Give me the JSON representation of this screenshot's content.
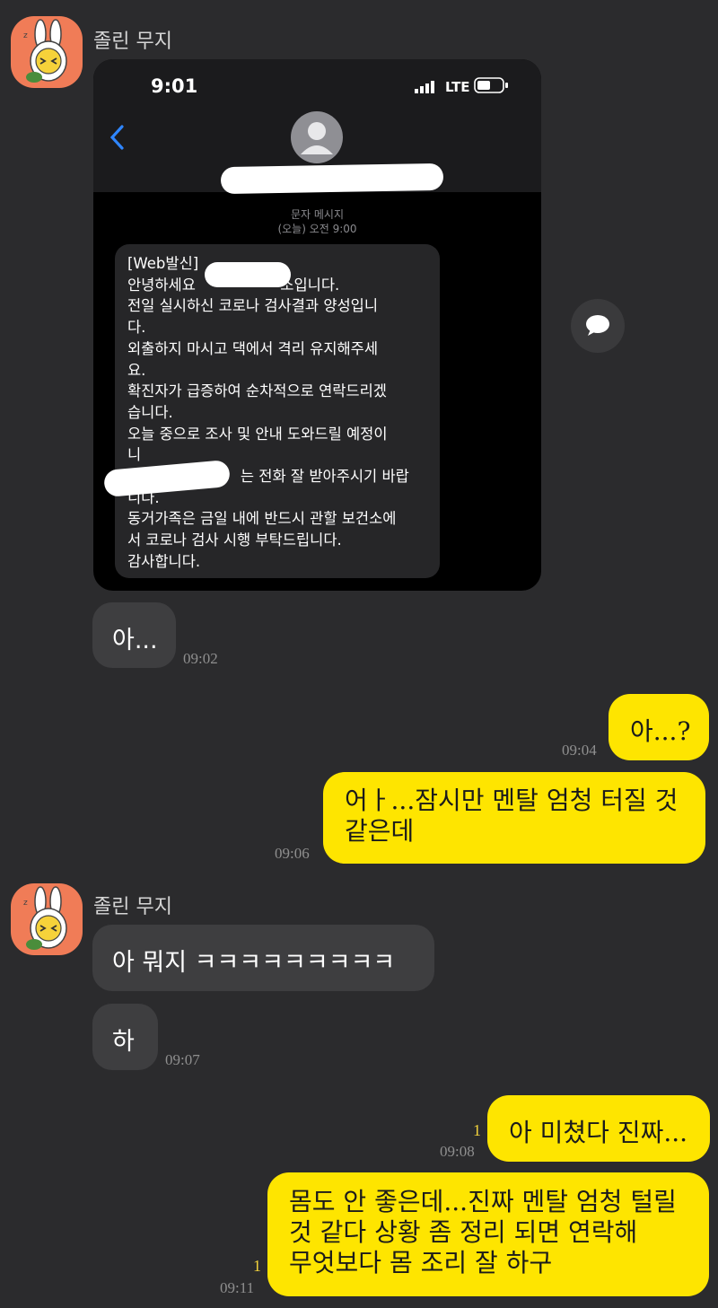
{
  "chat": {
    "contact_name": "졸린 무지",
    "contact_name_2": "졸린 무지"
  },
  "screenshot": {
    "status_time": "9:01",
    "network": "LTE",
    "message_type": "문자 메시지",
    "message_date": "(오늘) 오전 9:00",
    "sms_lines": [
      "[Web발신]",
      "안녕하세요                  소입니다.",
      "전일 실시하신 코로나 검사결과 양성입니",
      "다.",
      "외출하지 마시고 댁에서 격리 유지해주세",
      "요.",
      "확진자가 급증하여 순차적으로 연락드리겠",
      "습니다.",
      "오늘 중으로 조사 및 안내 도와드릴 예정이",
      "니",
      "                        는 전화 잘 받아주시기 바랍",
      "니다.",
      "동거가족은 금일 내에 반드시 관할 보건소에",
      "서 코로나 검사 시행 부탁드립니다.",
      "감사합니다."
    ]
  },
  "messages": [
    {
      "text": "아...",
      "time": "09:02"
    },
    {
      "text": "아...?",
      "time": "09:04"
    },
    {
      "line1": "어ㅏ...잠시만 멘탈 엄청 터질 것",
      "line2": "같은데",
      "time": "09:06"
    },
    {
      "text": "아 뭐지 ㅋㅋㅋㅋㅋㅋㅋㅋㅋ"
    },
    {
      "text": "하",
      "time": "09:07"
    },
    {
      "text": "아 미쳤다 진짜...",
      "time": "09:08",
      "unread": "1"
    },
    {
      "line1": "몸도 안 좋은데...진짜 멘탈 엄청 털릴",
      "line2": "것 같다 상황 좀 정리 되면 연락해",
      "line3": "무엇보다 몸 조리 잘 하구",
      "time": "09:11",
      "unread": "1"
    }
  ],
  "colors": {
    "background": "#2b2b2d",
    "incoming_bubble": "#3e3e40",
    "outgoing_bubble": "#fee500",
    "avatar_bg": "#f07c57"
  }
}
